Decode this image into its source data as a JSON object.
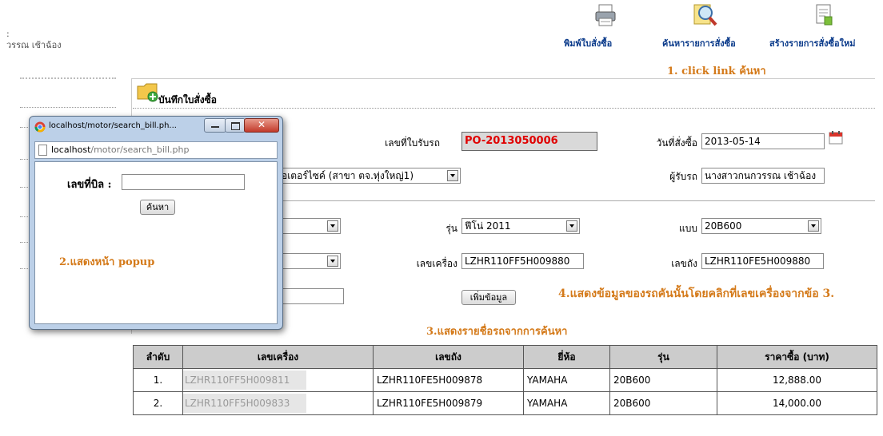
{
  "header": {
    "user_line1": ": ",
    "user_line2": "วรรณ  เช้าฉ้อง",
    "links": [
      {
        "label": "พิมพ์ใบสั่งซื้อ",
        "icon": "printer-icon"
      },
      {
        "label": "ค้นหารายการสั่งซื้อ",
        "icon": "search-icon"
      },
      {
        "label": "สร้างรายการสั่งซื้อใหม่",
        "icon": "new-document-icon"
      }
    ]
  },
  "annotations": {
    "a1": "1. click link ค้นหา",
    "a2": "2.แสดงหน้า popup",
    "a3": "3.แสดงรายชื่อรถจากการค้นหา",
    "a4": "4.แสดงข้อมูลของรถคันนั้นโดยคลิกที่เลขเครื่องจากข้อ 3."
  },
  "form": {
    "title": "บันทึกใบสั่งซื้อ",
    "receipt_label": "เลขที่ใบรับรถ",
    "receipt_value": "PO-2013050006",
    "order_date_label": "วันที่สั่งซื้อ",
    "order_date_value": "2013-05-14",
    "branch_value": "อเตอร์ไซค์ (สาขา ตจ.ทุ่งใหญ่1)",
    "receiver_label": "ผู้รับรถ",
    "receiver_value": "นางสาวกนกวรรณ เช้าฉ้อง",
    "model_label": "รุ่น",
    "model_value": "ฟีโน่ 2011",
    "type_label": "แบบ",
    "type_value": "20B600",
    "engine_label": "เลขเครื่อง",
    "engine_value": "LZHR110FF5H009880",
    "chassis_label": "เลขถัง",
    "chassis_value": "LZHR110FE5H009880",
    "add_button": "เพิ่มข้อมูล"
  },
  "popup": {
    "tab_title": "localhost/motor/search_bill.ph...",
    "url_host": "localhost",
    "url_path": "/motor/search_bill.php",
    "field_label": "เลขที่บิล :",
    "field_value": "",
    "search_button": "ค้นหา"
  },
  "table": {
    "headers": [
      "ลำดับ",
      "เลขเครื่อง",
      "เลขถัง",
      "ยี่ห้อ",
      "รุ่น",
      "ราคาซื้อ (บาท)"
    ],
    "rows": [
      [
        "1.",
        "LZHR110FF5H009811",
        "LZHR110FE5H009878",
        "YAMAHA",
        "20B600",
        "12,888.00"
      ],
      [
        "2.",
        "LZHR110FF5H009833",
        "LZHR110FE5H009879",
        "YAMAHA",
        "20B600",
        "14,000.00"
      ]
    ]
  },
  "colors": {
    "annotation": "#d47a1a",
    "receipt_text": "#e00000",
    "link": "#0a3a8a"
  }
}
